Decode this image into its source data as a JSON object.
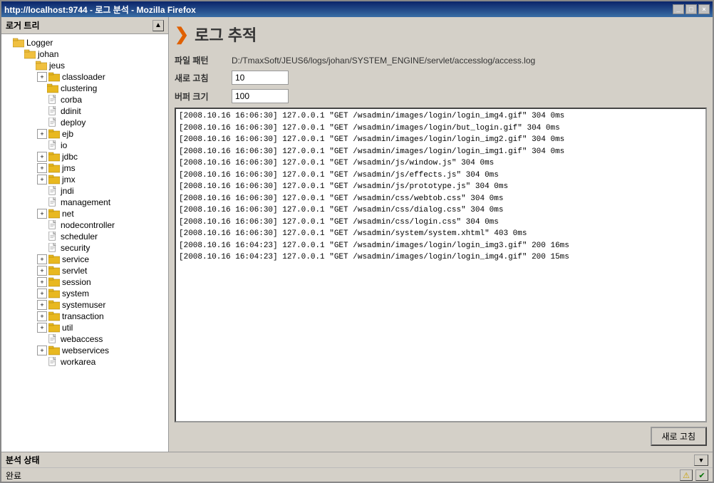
{
  "window": {
    "title": "http://localhost:9744 - 로그 분석 - Mozilla Firefox",
    "buttons": [
      "_",
      "□",
      "×"
    ]
  },
  "left_panel": {
    "header": "로거 트리",
    "tree": [
      {
        "id": "logger",
        "label": "Logger",
        "level": 0,
        "expanded": true,
        "has_expand": false,
        "type": "root"
      },
      {
        "id": "johan",
        "label": "johan",
        "level": 1,
        "expanded": true,
        "has_expand": false,
        "type": "folder"
      },
      {
        "id": "jeus",
        "label": "jeus",
        "level": 2,
        "expanded": true,
        "has_expand": false,
        "type": "folder"
      },
      {
        "id": "classloader",
        "label": "classloader",
        "level": 3,
        "expanded": false,
        "has_expand": true,
        "type": "folder"
      },
      {
        "id": "clustering",
        "label": "clustering",
        "level": 3,
        "expanded": false,
        "has_expand": false,
        "type": "folder"
      },
      {
        "id": "corba",
        "label": "corba",
        "level": 3,
        "expanded": false,
        "has_expand": false,
        "type": "file"
      },
      {
        "id": "ddinit",
        "label": "ddinit",
        "level": 3,
        "expanded": false,
        "has_expand": false,
        "type": "file"
      },
      {
        "id": "deploy",
        "label": "deploy",
        "level": 3,
        "expanded": false,
        "has_expand": false,
        "type": "file"
      },
      {
        "id": "ejb",
        "label": "ejb",
        "level": 3,
        "expanded": false,
        "has_expand": true,
        "type": "folder"
      },
      {
        "id": "io",
        "label": "io",
        "level": 3,
        "expanded": false,
        "has_expand": false,
        "type": "file"
      },
      {
        "id": "jdbc",
        "label": "jdbc",
        "level": 3,
        "expanded": false,
        "has_expand": true,
        "type": "folder"
      },
      {
        "id": "jms",
        "label": "jms",
        "level": 3,
        "expanded": false,
        "has_expand": true,
        "type": "folder"
      },
      {
        "id": "jmx",
        "label": "jmx",
        "level": 3,
        "expanded": false,
        "has_expand": true,
        "type": "folder"
      },
      {
        "id": "jndi",
        "label": "jndi",
        "level": 3,
        "expanded": false,
        "has_expand": false,
        "type": "file"
      },
      {
        "id": "management",
        "label": "management",
        "level": 3,
        "expanded": false,
        "has_expand": false,
        "type": "file"
      },
      {
        "id": "net",
        "label": "net",
        "level": 3,
        "expanded": false,
        "has_expand": true,
        "type": "folder"
      },
      {
        "id": "nodecontroller",
        "label": "nodecontroller",
        "level": 3,
        "expanded": false,
        "has_expand": false,
        "type": "file"
      },
      {
        "id": "scheduler",
        "label": "scheduler",
        "level": 3,
        "expanded": false,
        "has_expand": false,
        "type": "file"
      },
      {
        "id": "security",
        "label": "security",
        "level": 3,
        "expanded": false,
        "has_expand": false,
        "type": "file"
      },
      {
        "id": "service",
        "label": "service",
        "level": 3,
        "expanded": false,
        "has_expand": true,
        "type": "folder"
      },
      {
        "id": "servlet",
        "label": "servlet",
        "level": 3,
        "expanded": false,
        "has_expand": true,
        "type": "folder"
      },
      {
        "id": "session",
        "label": "session",
        "level": 3,
        "expanded": false,
        "has_expand": true,
        "type": "folder"
      },
      {
        "id": "system",
        "label": "system",
        "level": 3,
        "expanded": false,
        "has_expand": true,
        "type": "folder"
      },
      {
        "id": "systemuser",
        "label": "systemuser",
        "level": 3,
        "expanded": false,
        "has_expand": true,
        "type": "folder"
      },
      {
        "id": "transaction",
        "label": "transaction",
        "level": 3,
        "expanded": false,
        "has_expand": true,
        "type": "folder"
      },
      {
        "id": "util",
        "label": "util",
        "level": 3,
        "expanded": false,
        "has_expand": true,
        "type": "folder"
      },
      {
        "id": "webaccess",
        "label": "webaccess",
        "level": 3,
        "expanded": false,
        "has_expand": false,
        "type": "file"
      },
      {
        "id": "webservices",
        "label": "webservices",
        "level": 3,
        "expanded": false,
        "has_expand": true,
        "type": "folder"
      },
      {
        "id": "workarea",
        "label": "workarea",
        "level": 3,
        "expanded": false,
        "has_expand": false,
        "type": "file"
      }
    ]
  },
  "right_panel": {
    "page_title": "로그 추적",
    "form": {
      "file_pattern_label": "파일 패턴",
      "file_pattern_value": "D:/TmaxSoft/JEUS6/logs/johan/SYSTEM_ENGINE/servlet/accesslog/access.log",
      "refresh_interval_label": "새로 고침",
      "refresh_interval_value": "10",
      "buffer_size_label": "버퍼 크기",
      "buffer_size_value": "100"
    },
    "log_entries": [
      "[2008.10.16 16:06:30] 127.0.0.1 \"GET /wsadmin/images/login/login_img4.gif\" 304 0ms",
      "[2008.10.16 16:06:30] 127.0.0.1 \"GET /wsadmin/images/login/but_login.gif\" 304 0ms",
      "[2008.10.16 16:06:30] 127.0.0.1 \"GET /wsadmin/images/login/login_img2.gif\" 304 0ms",
      "[2008.10.16 16:06:30] 127.0.0.1 \"GET /wsadmin/images/login/login_img1.gif\" 304 0ms",
      "[2008.10.16 16:06:30] 127.0.0.1 \"GET /wsadmin/js/window.js\" 304 0ms",
      "[2008.10.16 16:06:30] 127.0.0.1 \"GET /wsadmin/js/effects.js\" 304 0ms",
      "[2008.10.16 16:06:30] 127.0.0.1 \"GET /wsadmin/js/prototype.js\" 304 0ms",
      "[2008.10.16 16:06:30] 127.0.0.1 \"GET /wsadmin/css/webtob.css\" 304 0ms",
      "[2008.10.16 16:06:30] 127.0.0.1 \"GET /wsadmin/css/dialog.css\" 304 0ms",
      "[2008.10.16 16:06:30] 127.0.0.1 \"GET /wsadmin/css/login.css\" 304 0ms",
      "[2008.10.16 16:06:30] 127.0.0.1 \"GET /wsadmin/system/system.xhtml\" 403 0ms",
      "[2008.10.16 16:04:23] 127.0.0.1 \"GET /wsadmin/images/login/login_img3.gif\" 200 16ms",
      "[2008.10.16 16:04:23] 127.0.0.1 \"GET /wsadmin/images/login/login_img4.gif\" 200 15ms"
    ],
    "refresh_button": "새로 고침"
  },
  "status_bar": {
    "label": "분석 상태",
    "status_text": "완료",
    "icons": [
      "warning",
      "ok"
    ]
  }
}
